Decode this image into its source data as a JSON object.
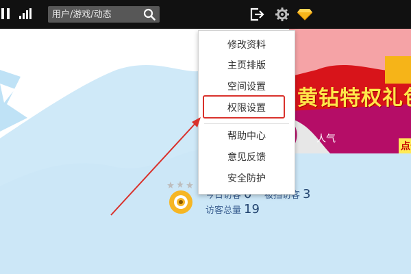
{
  "topbar": {
    "search": {
      "placeholder": "用户/游戏/动态",
      "value": ""
    },
    "icons": [
      "pause-icon",
      "signal-bars-icon",
      "search-icon",
      "logout-icon",
      "gear-icon",
      "diamond-icon"
    ]
  },
  "promo": {
    "headline": "黄钻特权礼包",
    "subtext": "人气",
    "point_label": "点击"
  },
  "stats": {
    "today": {
      "label": "今日访客",
      "value": "0"
    },
    "blocked": {
      "label": "被挡访客",
      "value": "3"
    },
    "total": {
      "label": "访客总量",
      "value": "19"
    }
  },
  "menu": {
    "items": [
      {
        "label": "修改资料"
      },
      {
        "label": "主页排版"
      },
      {
        "label": "空间设置"
      },
      {
        "label": "权限设置",
        "highlighted": true
      },
      {
        "label": "帮助中心"
      },
      {
        "label": "意见反馈"
      },
      {
        "label": "安全防护"
      }
    ]
  },
  "colors": {
    "topbar": "#111111",
    "accent_red": "#d9312b",
    "sky": "#cfe9f8",
    "stat_text": "#3a5f91"
  }
}
